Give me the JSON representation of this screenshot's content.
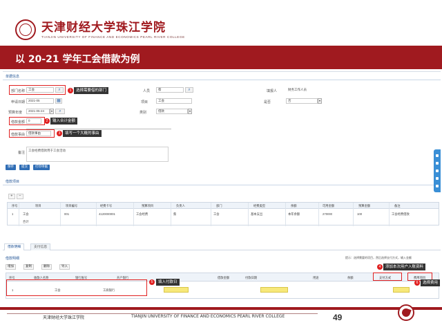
{
  "header": {
    "school_name_cn": "天津财经大学珠江学院",
    "school_name_en": "TIANJIN UNIVERSITY OF FINANCE AND ECONOMICS PEARL RIVER COLLEGE",
    "slide_title": "以 20-21 学年工会借款为例"
  },
  "form": {
    "section_title": "单据信息",
    "dept_label": "部门名称",
    "dept_value": "工会",
    "field2_label": "人员",
    "field2_value": "蔡",
    "field3_label": "填报人",
    "field3_value": "财务工作人员",
    "date_label": "申请日期",
    "date_value": "2021-05",
    "field5_label": "项目",
    "field5_value": "工会",
    "field6_label": "是否",
    "field6_value": "否",
    "budget_label": "预算年度",
    "budget_value": "2021-05-24",
    "field8_label": "类别",
    "field8_value": "借款",
    "amount_label": "借款金额",
    "amount_value": "0",
    "reason_label": "借款事由",
    "reason_value": "借款事由",
    "remark_label": "备注",
    "remark_value": "工会经费借款用于工会活动"
  },
  "callouts": {
    "c1": "选择需要借的部门",
    "c2": "输入合计金额",
    "c3": "填写一个大概的事由",
    "c4": "添加本次用户入账资料",
    "c5": "填入付款日",
    "c6": "选择费用"
  },
  "badges": {
    "b1": "1",
    "b2": "2",
    "b3": "3",
    "b4": "4",
    "b5": "5",
    "b6": "6"
  },
  "buttons": {
    "save": "保存",
    "submit": "提交",
    "print": "打印单据"
  },
  "project_section": {
    "title": "借款项目",
    "headers": [
      "序号",
      "项目",
      "项目编号",
      "经费卡号",
      "预算项目",
      "负责人",
      "部门",
      "经费类型",
      "余额",
      "可用金额",
      "预算金额",
      "备注"
    ],
    "rows": [
      [
        "1",
        "工会",
        "001",
        "4120000001",
        "工会经费",
        "蔡",
        "工会",
        "基本支出",
        "本年余额",
        "270000",
        "100",
        "工会经费借款"
      ],
      [
        "",
        "合计",
        "",
        "",
        "",
        "",
        "",
        "",
        "",
        "",
        "",
        ""
      ]
    ]
  },
  "tabs": {
    "tab1": "借款明细",
    "tab2": "支付信息"
  },
  "detail_section": {
    "toolbar_text": "借款明细",
    "tool_add": "增加",
    "tool_copy": "复制",
    "tool_delete": "删除",
    "tool_more": "导入",
    "right_hint": "提示：选择需要的项目，然后选择支付方式，输入金额",
    "headers": [
      "序号",
      "收款人名称",
      "银行账号",
      "开户银行",
      "支付方式",
      "借款金额",
      "付款日期",
      "用途",
      "余额",
      "备注"
    ],
    "row": [
      "1",
      "工会",
      "",
      "工商银行",
      "",
      "",
      "",
      "",
      "",
      ""
    ],
    "pay_col_label": "支付方式",
    "cost_col_label": "费用项目"
  },
  "footer": {
    "school_cn": "天津财经大学珠江学院",
    "school_en": "TIANJIN UNIVERSITY OF FINANCE AND ECONOMICS PEARL RIVER COLLEGE",
    "page_number": "49"
  },
  "colors": {
    "brand": "#a01a1f",
    "callout_bg": "#333333",
    "highlight": "#e02020",
    "accent": "#2f6db5"
  }
}
